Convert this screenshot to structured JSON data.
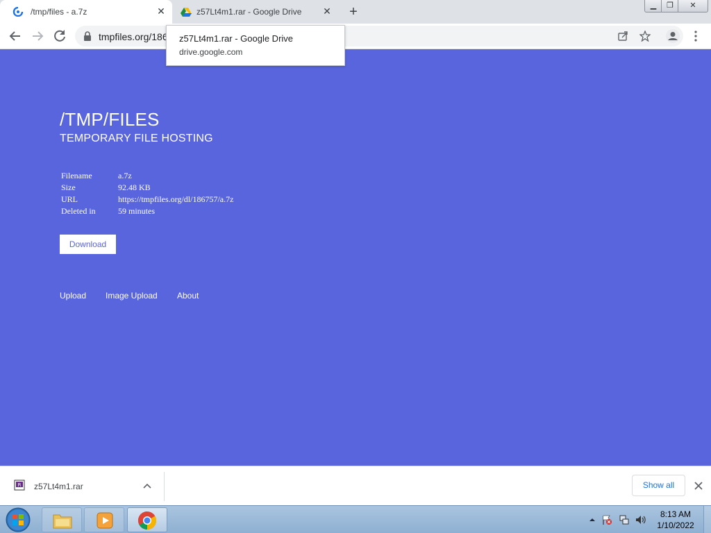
{
  "browser": {
    "tabs": [
      {
        "title": "/tmp/files - a.7z",
        "active": true
      },
      {
        "title": "z57Lt4m1.rar - Google Drive",
        "active": false
      }
    ],
    "new_tab": "+",
    "address": "tmpfiles.org/186"
  },
  "tooltip": {
    "title": "z57Lt4m1.rar - Google Drive",
    "domain": "drive.google.com"
  },
  "page": {
    "title": "/TMP/FILES",
    "subtitle": "TEMPORARY FILE HOSTING",
    "info": [
      {
        "key": "Filename",
        "value": "a.7z"
      },
      {
        "key": "Size",
        "value": "92.48 KB"
      },
      {
        "key": "URL",
        "value": "https://tmpfiles.org/dl/186757/a.7z"
      },
      {
        "key": "Deleted in",
        "value": "59 minutes"
      }
    ],
    "download_label": "Download",
    "links": [
      "Upload",
      "Image Upload",
      "About"
    ]
  },
  "download_shelf": {
    "file_name": "z57Lt4m1.rar",
    "show_all": "Show all"
  },
  "taskbar": {
    "time": "8:13 AM",
    "date": "1/10/2022"
  },
  "colors": {
    "page_bg": "#5865dd",
    "button_text": "#5865dd",
    "link_blue": "#1a73e8"
  }
}
